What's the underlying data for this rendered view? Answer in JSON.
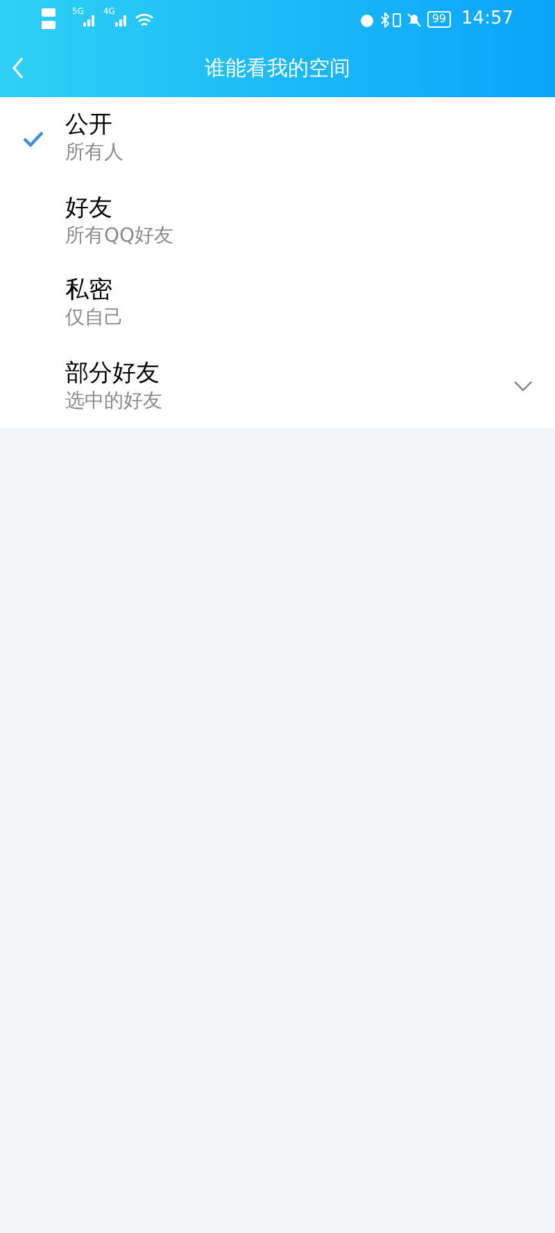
{
  "status_bar": {
    "network_1": "5G",
    "network_2": "4G",
    "battery": "99",
    "time": "14:57"
  },
  "header": {
    "title": "谁能看我的空间"
  },
  "options": [
    {
      "title": "公开",
      "subtitle": "所有人",
      "selected": true,
      "kind": "option"
    },
    {
      "title": "好友",
      "subtitle": "所有QQ好友",
      "selected": false,
      "kind": "option"
    },
    {
      "title": "私密",
      "subtitle": "仅自己",
      "selected": false,
      "kind": "option"
    },
    {
      "title": "部分好友",
      "subtitle": "选中的好友",
      "selected": false,
      "kind": "expandable"
    }
  ]
}
